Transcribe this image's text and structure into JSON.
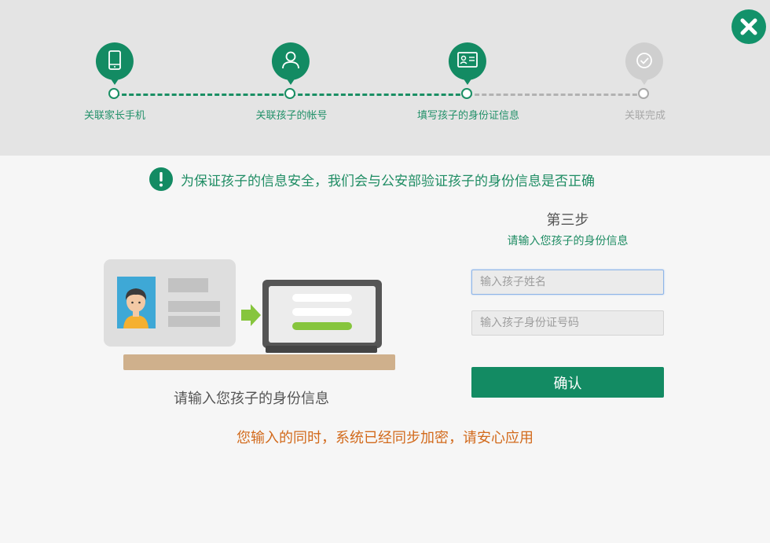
{
  "steps": [
    {
      "label": "关联家长手机",
      "icon": "phone-icon",
      "status": "done"
    },
    {
      "label": "关联孩子的帐号",
      "icon": "user-icon",
      "status": "done"
    },
    {
      "label": "填写孩子的身份证信息",
      "icon": "id-card-icon",
      "status": "current"
    },
    {
      "label": "关联完成",
      "icon": "check-circle-icon",
      "status": "pending"
    }
  ],
  "notice": {
    "icon": "exclamation-icon",
    "text": "为保证孩子的信息安全，我们会与公安部验证孩子的身份信息是否正确"
  },
  "illustration": {
    "caption": "请输入您孩子的身份信息"
  },
  "form": {
    "step_title": "第三步",
    "step_subtitle": "请输入您孩子的身份信息",
    "name_placeholder": "输入孩子姓名",
    "name_value": "",
    "id_placeholder": "输入孩子身份证号码",
    "id_value": "",
    "confirm_label": "确认"
  },
  "bottom_note": "您输入的同时，系统已经同步加密，请安心应用",
  "colors": {
    "accent": "#138b63",
    "inactive": "#b2b2b2",
    "warning_text": "#d26a1c"
  }
}
